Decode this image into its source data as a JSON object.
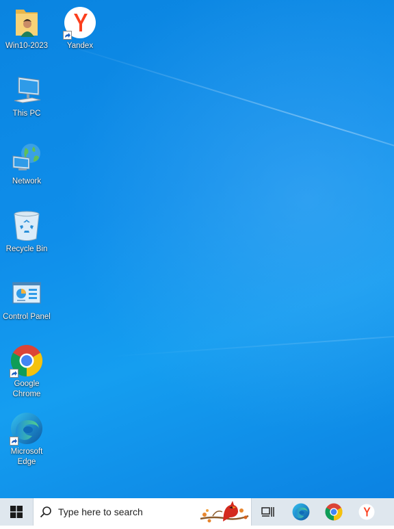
{
  "desktop": {
    "icons": [
      {
        "label": "Win10-2023",
        "icon": "user-folder-icon"
      },
      {
        "label": "Yandex",
        "icon": "yandex-icon"
      },
      {
        "label": "This PC",
        "icon": "computer-icon"
      },
      {
        "label": "Network",
        "icon": "network-icon"
      },
      {
        "label": "Recycle Bin",
        "icon": "recycle-bin-icon"
      },
      {
        "label": "Control Panel",
        "icon": "control-panel-icon"
      },
      {
        "label": "Google\nChrome",
        "icon": "chrome-icon"
      },
      {
        "label": "Microsoft\nEdge",
        "icon": "edge-icon"
      }
    ]
  },
  "taskbar": {
    "start_icon": "windows-logo-icon",
    "search": {
      "placeholder": "Type here to search",
      "icon": "search-icon",
      "highlight_icon": "cardinal-bird-icon"
    },
    "pinned": [
      {
        "name": "task-view",
        "icon": "task-view-icon"
      },
      {
        "name": "microsoft-edge",
        "icon": "edge-icon"
      },
      {
        "name": "google-chrome",
        "icon": "chrome-icon"
      },
      {
        "name": "yandex",
        "icon": "yandex-icon"
      }
    ]
  },
  "colors": {
    "wallpaper": "#0f8eea",
    "taskbar": "#dfe7ee",
    "yandex_red": "#fc3f1d"
  }
}
